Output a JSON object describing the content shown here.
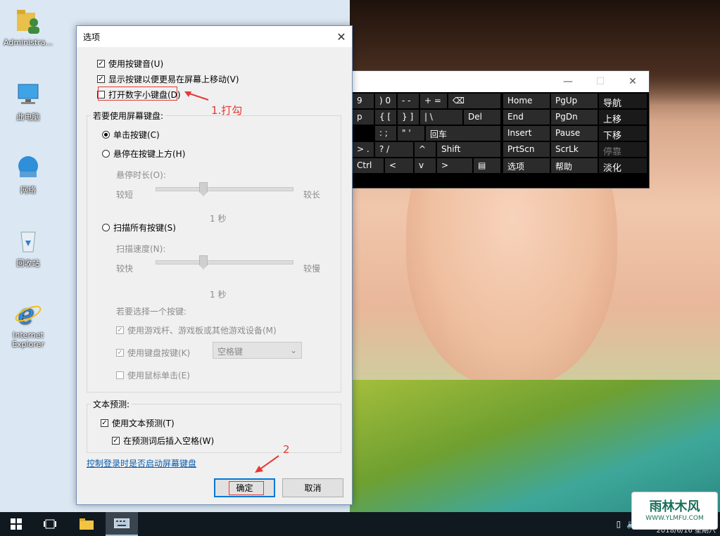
{
  "desktop": {
    "icons": [
      {
        "label": "Administra...",
        "icon": "user-folder-icon"
      },
      {
        "label": "此电脑",
        "icon": "this-pc-icon"
      },
      {
        "label": "网络",
        "icon": "network-icon"
      },
      {
        "label": "回收站",
        "icon": "recycle-bin-icon"
      },
      {
        "label": "Internet Explorer",
        "icon": "internet-explorer-icon"
      }
    ]
  },
  "dialog": {
    "title": "选项",
    "close": "✕",
    "checkboxes_top": [
      {
        "label": "使用按键音(U)",
        "checked": true
      },
      {
        "label": "显示按键以便更易在屏幕上移动(V)",
        "checked": true
      },
      {
        "label": "打开数字小键盘(D)",
        "checked": false
      }
    ],
    "screen_kb_group": {
      "label": "若要使用屏幕键盘:",
      "radio_click": "单击按键(C)",
      "radio_hover": "悬停在按键上方(H)",
      "hover_duration_label": "悬停时长(O):",
      "short": "较短",
      "long": "较长",
      "hover_value": "1 秒",
      "radio_scan": "扫描所有按键(S)",
      "scan_speed_label": "扫描速度(N):",
      "fast": "较快",
      "slow": "较慢",
      "scan_value": "1 秒",
      "select_key_label": "若要选择一个按键:",
      "opt_gamepad": "使用游戏杆、游戏板或其他游戏设备(M)",
      "opt_keyboard": "使用键盘按键(K)",
      "keyboard_key_value": "空格键",
      "opt_mouse": "使用鼠标单击(E)"
    },
    "text_prediction": {
      "label": "文本预测:",
      "use": "使用文本预测(T)",
      "insert_space": "在预测词后插入空格(W)"
    },
    "link": "控制登录时是否启动屏幕键盘",
    "ok": "确定",
    "cancel": "取消"
  },
  "annotations": {
    "step1": "1.打勾",
    "step2": "2"
  },
  "osk": {
    "row1": [
      "9",
      ") 0",
      "- -",
      "+ =",
      "⌫"
    ],
    "row2": [
      "p",
      "{ [",
      "} ]",
      "| \\",
      "Del"
    ],
    "row3": [
      ": ;",
      "\" '",
      "回车"
    ],
    "row4": [
      "> .",
      "? /",
      "^",
      "Shift"
    ],
    "row5": [
      "Ctrl",
      "<",
      "v",
      ">",
      "▤"
    ],
    "right_col1": [
      "Home",
      "End",
      "Insert",
      "PrtScn",
      "选项"
    ],
    "right_col2": [
      "PgUp",
      "PgDn",
      "Pause",
      "ScrLk",
      "帮助"
    ],
    "right_col3": [
      "导航",
      "上移",
      "下移",
      "停靠",
      "淡化"
    ]
  },
  "taskbar": {
    "clock_date": "2018/6/16 星期六"
  },
  "watermark": {
    "title": "雨林木风",
    "url": "WWW.YLMFU.COM"
  },
  "colors": {
    "accent": "#0078d7",
    "annotation_red": "#e53935",
    "link": "#0b5cad"
  }
}
